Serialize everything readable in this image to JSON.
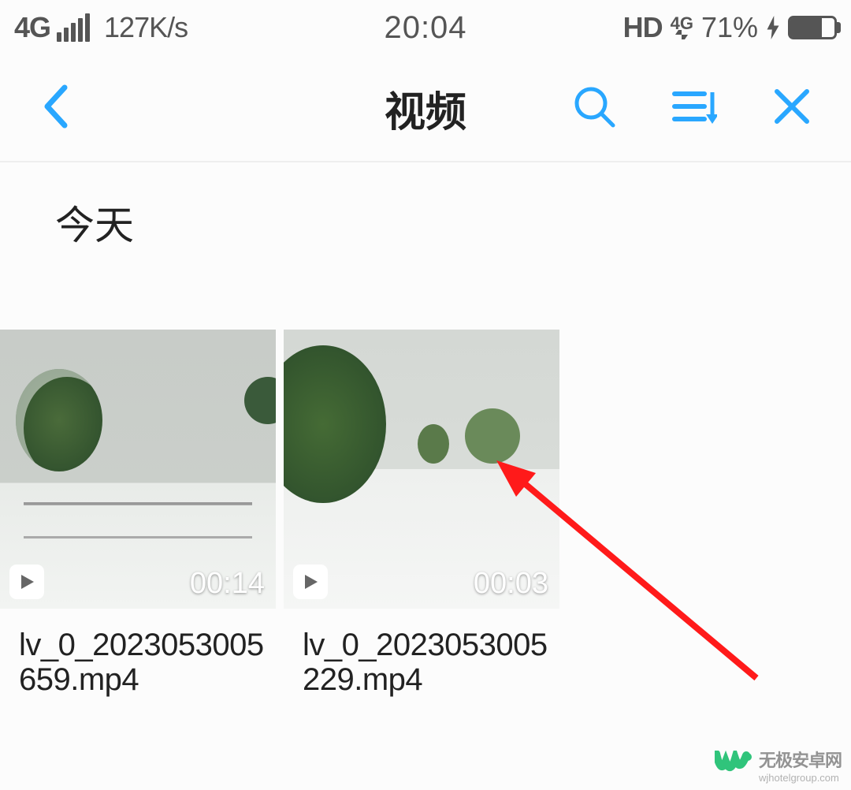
{
  "status_bar": {
    "network": "4G",
    "speed": "127K/s",
    "time": "20:04",
    "hd": "HD",
    "fourg_small": "4G",
    "battery_pct": "71%"
  },
  "header": {
    "title": "视频"
  },
  "section": {
    "label": "今天"
  },
  "videos": [
    {
      "duration": "00:14",
      "filename": "lv_0_2023053005659.mp4"
    },
    {
      "duration": "00:03",
      "filename": "lv_0_2023053005229.mp4"
    }
  ],
  "watermark": {
    "main": "无极安卓网",
    "sub": "wjhotelgroup.com"
  }
}
